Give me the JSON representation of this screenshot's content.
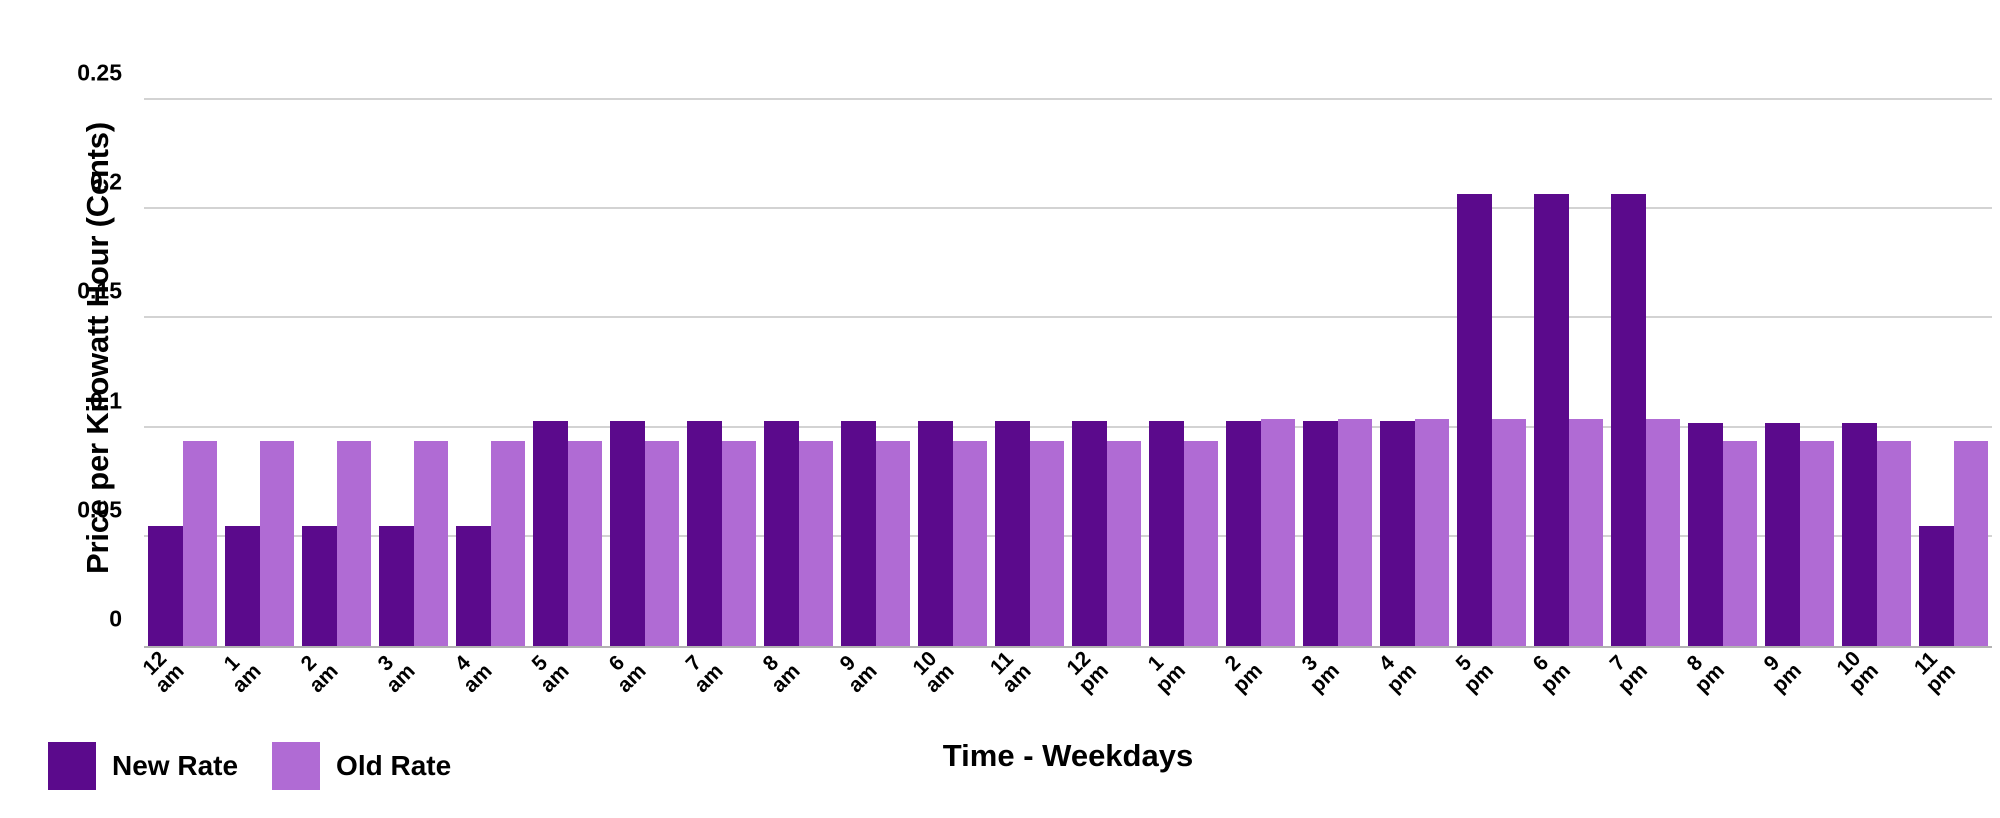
{
  "chart_data": {
    "type": "bar",
    "title": "",
    "xlabel": "Time - Weekdays",
    "ylabel": "Price per Kilowatt Hour (Cents)",
    "ylim": [
      0,
      0.25
    ],
    "yticks": [
      "0",
      "0.05",
      "0.1",
      "0.15",
      "0.2",
      "0.25"
    ],
    "ytick_values": [
      0,
      0.05,
      0.1,
      0.15,
      0.2,
      0.25
    ],
    "grid": true,
    "legend_position": "bottom-left",
    "categories": [
      "12 am",
      "1 am",
      "2 am",
      "3 am",
      "4 am",
      "5 am",
      "6 am",
      "7 am",
      "8 am",
      "9 am",
      "10 am",
      "11 am",
      "12 pm",
      "1 pm",
      "2 pm",
      "3 pm",
      "4 pm",
      "5 pm",
      "6 pm",
      "7 pm",
      "8 pm",
      "9 pm",
      "10 pm",
      "11 pm"
    ],
    "series": [
      {
        "name": "New Rate",
        "color": "#5B0A8C",
        "values": [
          0.055,
          0.055,
          0.055,
          0.055,
          0.055,
          0.103,
          0.103,
          0.103,
          0.103,
          0.103,
          0.103,
          0.103,
          0.103,
          0.103,
          0.103,
          0.103,
          0.103,
          0.207,
          0.207,
          0.207,
          0.102,
          0.102,
          0.102,
          0.055
        ]
      },
      {
        "name": "Old Rate",
        "color": "#B06BD4",
        "values": [
          0.094,
          0.094,
          0.094,
          0.094,
          0.094,
          0.094,
          0.094,
          0.094,
          0.094,
          0.094,
          0.094,
          0.094,
          0.094,
          0.094,
          0.104,
          0.104,
          0.104,
          0.104,
          0.104,
          0.104,
          0.094,
          0.094,
          0.094,
          0.094
        ]
      }
    ]
  },
  "legend": {
    "items": [
      {
        "label": "New Rate",
        "color": "#5B0A8C"
      },
      {
        "label": "Old Rate",
        "color": "#B06BD4"
      }
    ]
  },
  "colors": {
    "new_rate": "#5B0A8C",
    "old_rate": "#B06BD4",
    "gridline": "#d3d3d3",
    "axis": "#b3b3b3",
    "text": "#000000",
    "background": "#ffffff"
  }
}
